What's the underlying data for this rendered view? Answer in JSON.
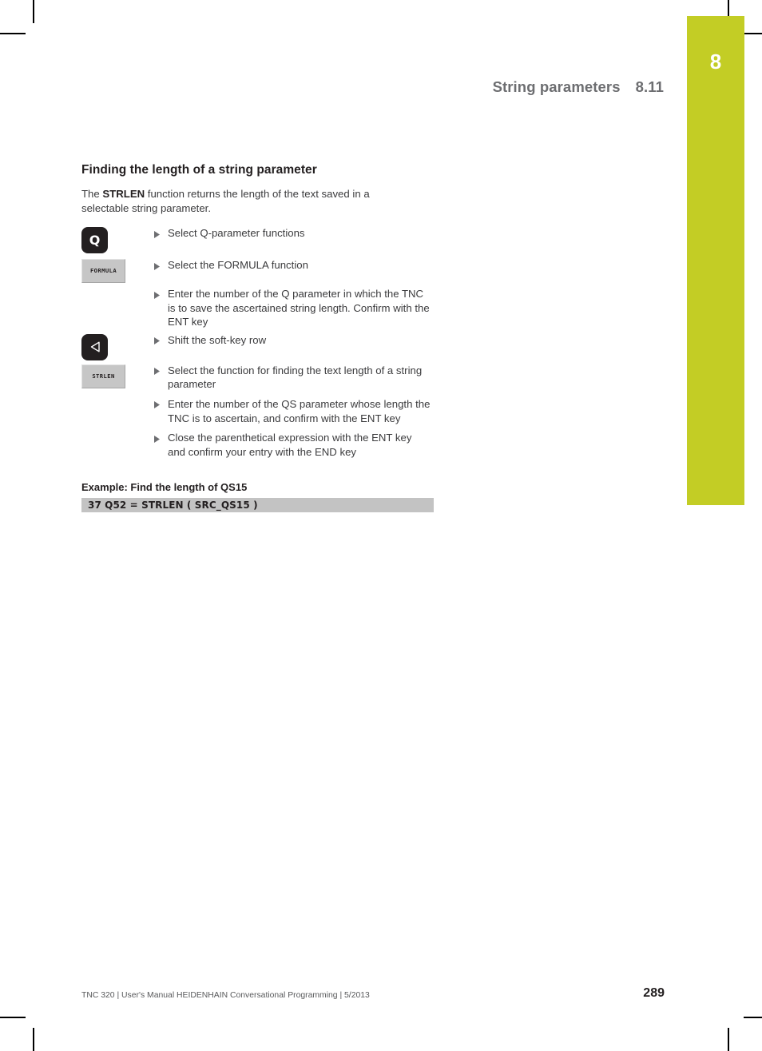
{
  "header": {
    "title": "String parameters",
    "section_number": "8.11",
    "chapter_tab_number": "8",
    "accent_color": "#c3cd25"
  },
  "content": {
    "section_heading": "Finding the length of a string parameter",
    "intro_before": "The ",
    "intro_bold": "STRLEN",
    "intro_after": " function returns the length of the text saved in a selectable string parameter.",
    "steps": [
      {
        "key_type": "hardkey-letter",
        "key_label": "Q",
        "key_icon": "q-key-icon",
        "text": "Select Q-parameter functions"
      },
      {
        "key_type": "softkey",
        "key_label": "FORMULA",
        "key_icon": "formula-softkey-icon",
        "text": "Select the FORMULA function"
      },
      {
        "key_type": "none",
        "key_label": "",
        "key_icon": "",
        "text": "Enter the number of the Q parameter in which the TNC is to save the ascertained string length. Confirm with the ENT key"
      },
      {
        "key_type": "hardkey-arrow",
        "key_label": "",
        "key_icon": "left-triangle-key-icon",
        "text": "Shift the soft-key row"
      },
      {
        "key_type": "softkey",
        "key_label": "STRLEN",
        "key_icon": "strlen-softkey-icon",
        "text": "Select the function for finding the text length of a string parameter"
      },
      {
        "key_type": "none",
        "key_label": "",
        "key_icon": "",
        "text": "Enter the number of the QS parameter whose length the TNC is to ascertain, and confirm with the ENT key"
      },
      {
        "key_type": "none",
        "key_label": "",
        "key_icon": "",
        "text": "Close the parenthetical expression with the ENT key and confirm your entry with the END key"
      }
    ]
  },
  "example": {
    "heading": "Example: Find the length of QS15",
    "code_line": "37 Q52 = STRLEN ( SRC_QS15 )",
    "code_background": "#c3c3c3"
  },
  "footer": {
    "text": "TNC 320 | User's Manual HEIDENHAIN Conversational Programming | 5/2013",
    "page_number": "289"
  }
}
